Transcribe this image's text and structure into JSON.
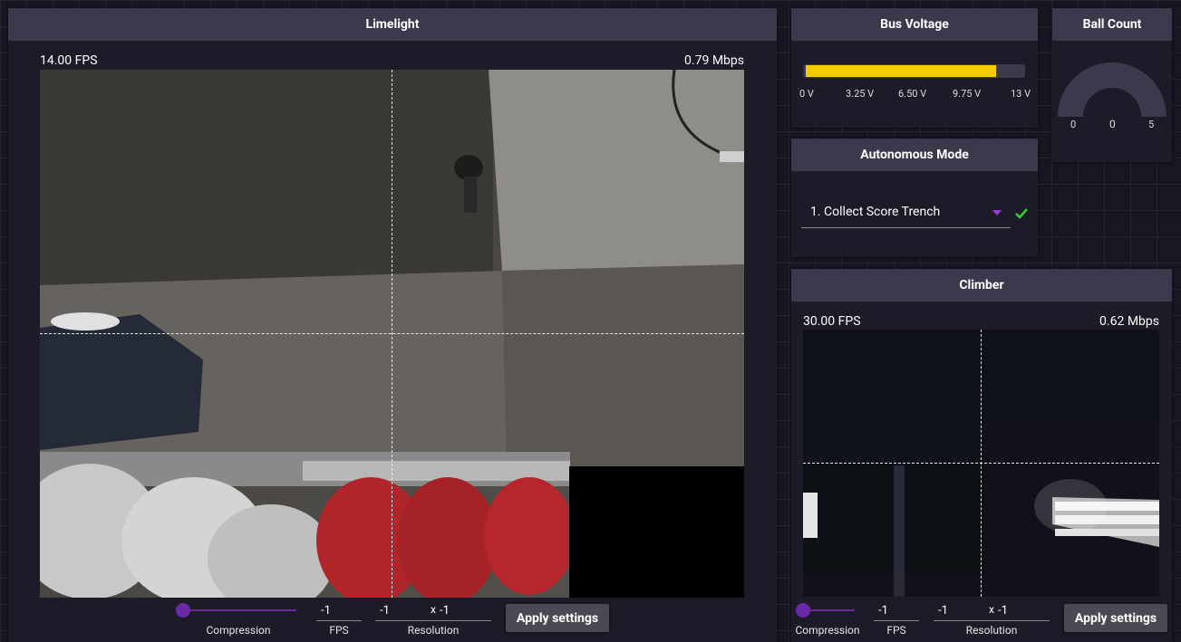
{
  "limelight": {
    "title": "Limelight",
    "fps": "14.00 FPS",
    "bitrate": "0.79 Mbps",
    "controls": {
      "compression_label": "Compression",
      "fps_value": "-1",
      "fps_label": "FPS",
      "res_w": "-1",
      "res_x": "x",
      "res_h": "-1",
      "resolution_label": "Resolution",
      "apply_label": "Apply settings"
    }
  },
  "bus_voltage": {
    "title": "Bus Voltage",
    "value_fraction": 0.88,
    "ticks": [
      "0 V",
      "3.25 V",
      "6.50 V",
      "9.75 V",
      "13 V"
    ],
    "bar_color": "#f2cc00"
  },
  "ball_count": {
    "title": "Ball Count",
    "min": "0",
    "value": "0",
    "max": "5"
  },
  "autonomous": {
    "title": "Autonomous Mode",
    "selected": "1. Collect Score Trench",
    "dropdown_icon": "caret-down-icon",
    "status_icon": "check-icon",
    "accent": "#9b3cdc",
    "status_color": "#2fd12f"
  },
  "climber": {
    "title": "Climber",
    "fps": "30.00 FPS",
    "bitrate": "0.62 Mbps",
    "controls": {
      "compression_label": "Compression",
      "fps_value": "-1",
      "fps_label": "FPS",
      "res_w": "-1",
      "res_x": "x",
      "res_h": "-1",
      "resolution_label": "Resolution",
      "apply_label": "Apply settings"
    }
  }
}
